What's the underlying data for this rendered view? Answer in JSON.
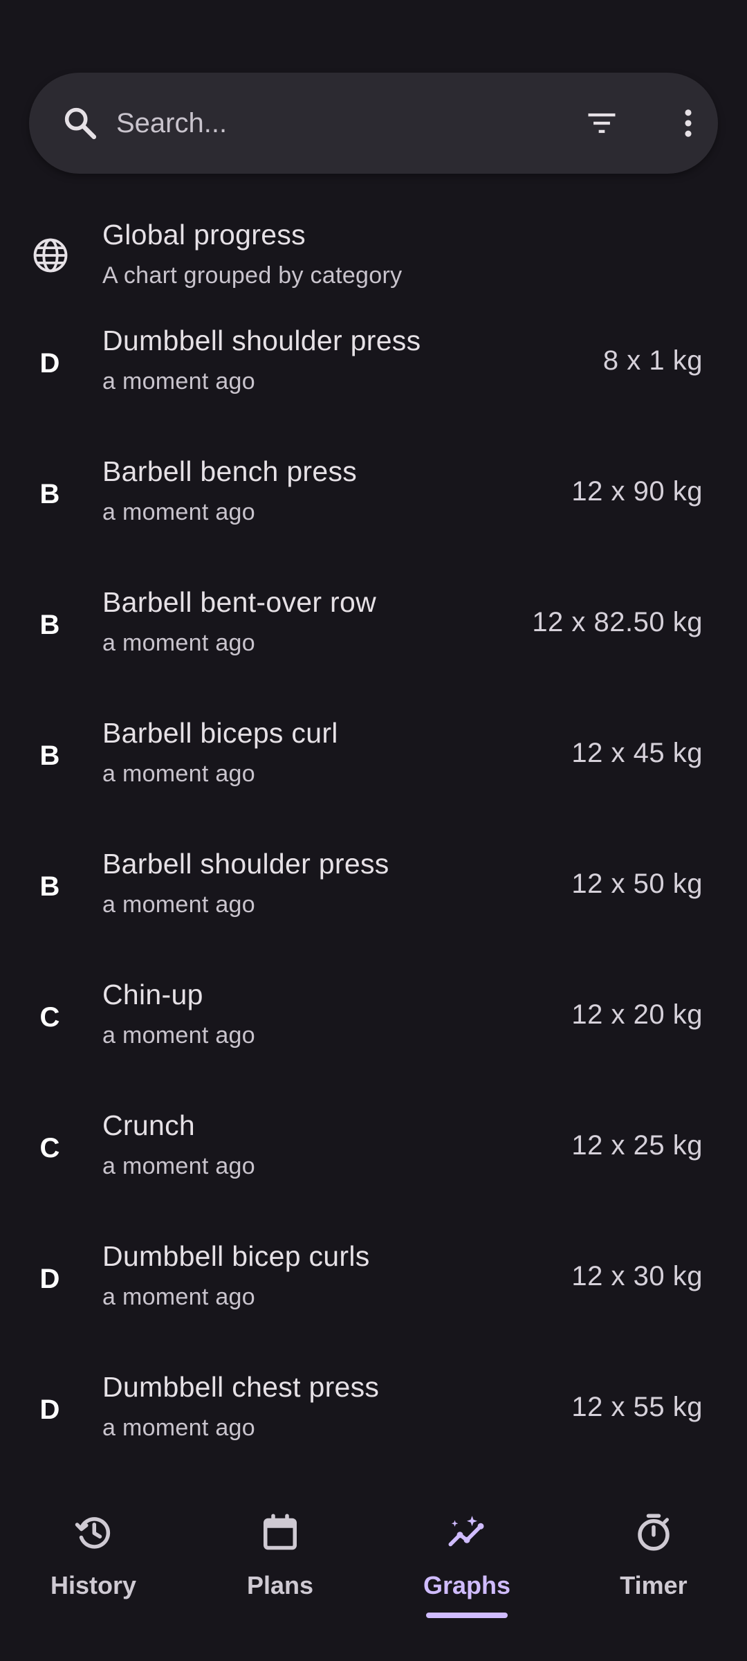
{
  "search": {
    "placeholder": "Search..."
  },
  "global": {
    "title": "Global progress",
    "subtitle": "A chart grouped by category"
  },
  "exercises": [
    {
      "initial": "D",
      "name": "Dumbbell shoulder press",
      "time": "a moment ago",
      "value": "8 x 1 kg"
    },
    {
      "initial": "B",
      "name": "Barbell bench press",
      "time": "a moment ago",
      "value": "12 x 90 kg"
    },
    {
      "initial": "B",
      "name": "Barbell bent-over row",
      "time": "a moment ago",
      "value": "12 x 82.50 kg"
    },
    {
      "initial": "B",
      "name": "Barbell biceps curl",
      "time": "a moment ago",
      "value": "12 x 45 kg"
    },
    {
      "initial": "B",
      "name": "Barbell shoulder press",
      "time": "a moment ago",
      "value": "12 x 50 kg"
    },
    {
      "initial": "C",
      "name": "Chin-up",
      "time": "a moment ago",
      "value": "12 x 20 kg"
    },
    {
      "initial": "C",
      "name": "Crunch",
      "time": "a moment ago",
      "value": "12 x 25 kg"
    },
    {
      "initial": "D",
      "name": "Dumbbell bicep curls",
      "time": "a moment ago",
      "value": "12 x 30 kg"
    },
    {
      "initial": "D",
      "name": "Dumbbell chest press",
      "time": "a moment ago",
      "value": "12 x 55 kg"
    }
  ],
  "nav": {
    "items": [
      {
        "label": "History",
        "icon": "history-icon"
      },
      {
        "label": "Plans",
        "icon": "calendar-icon"
      },
      {
        "label": "Graphs",
        "icon": "graph-icon"
      },
      {
        "label": "Timer",
        "icon": "timer-icon"
      }
    ],
    "active": "Graphs"
  },
  "colors": {
    "background": "#17151b",
    "search_bar": "#2c2a31",
    "accent": "#d0bcff",
    "text": "#e6e1e6",
    "secondary_text": "#c9c4cd"
  }
}
